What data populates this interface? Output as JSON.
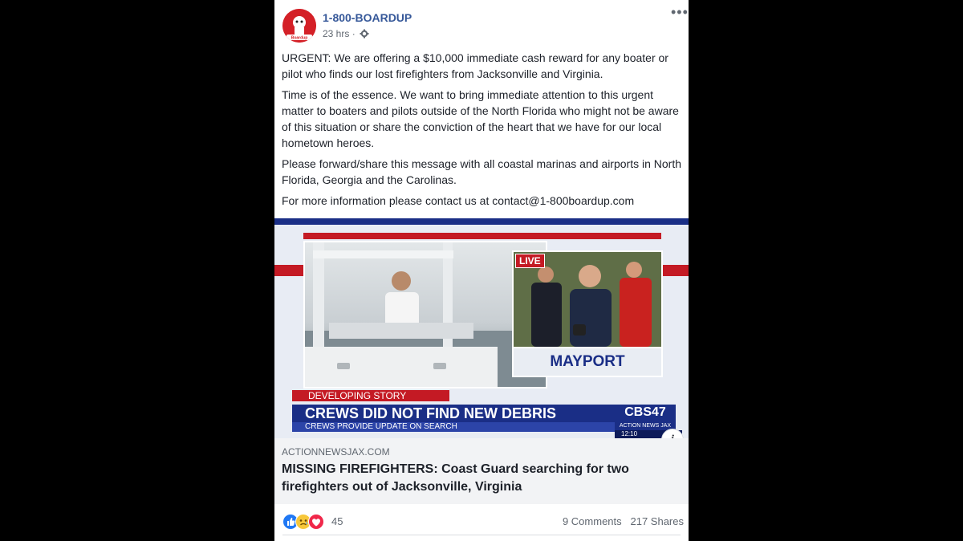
{
  "post": {
    "page_name": "1-800-BOARDUP",
    "timestamp": "23 hrs",
    "separator": "·",
    "more_label": "•••",
    "avatar_text": "Boardup",
    "message": [
      "URGENT: We are offering a $10,000 immediate cash reward for any boater or pilot who finds our lost firefighters from Jacksonville and Virginia.",
      "Time is of the essence. We want to bring immediate attention to this urgent matter to boaters and pilots outside of the North Florida who might not be aware of this situation or share the conviction of the heart that we have for our local hometown heroes.",
      "Please forward/share this message with all coastal marinas and airports in North Florida, Georgia and the Carolinas.",
      "For more information please contact us at contact@1-800boardup.com"
    ]
  },
  "media": {
    "live_label": "LIVE",
    "location": "MAYPORT",
    "developing_label": "DEVELOPING STORY",
    "headline": "CREWS DID NOT FIND NEW DEBRIS",
    "subheadline": "CREWS PROVIDE UPDATE ON SEARCH",
    "station_logo": "CBS47",
    "station_sub": "ACTION NEWS JAX",
    "clock": "12:10",
    "info_label": "i"
  },
  "link": {
    "domain": "ACTIONNEWSJAX.COM",
    "title": "MISSING FIREFIGHTERS: Coast Guard searching for two firefighters out of Jacksonville, Virginia"
  },
  "footer": {
    "reaction_count": "45",
    "comments": "9 Comments",
    "shares": "217 Shares"
  },
  "colors": {
    "page_name": "#365899",
    "brand_red": "#c41a24",
    "news_blue": "#1a2e86",
    "like_blue": "#2078f4",
    "love_red": "#f0284a"
  },
  "icons": [
    "gear-icon",
    "more-options-icon",
    "like-reaction-icon",
    "sad-reaction-icon",
    "love-reaction-icon",
    "info-icon"
  ]
}
